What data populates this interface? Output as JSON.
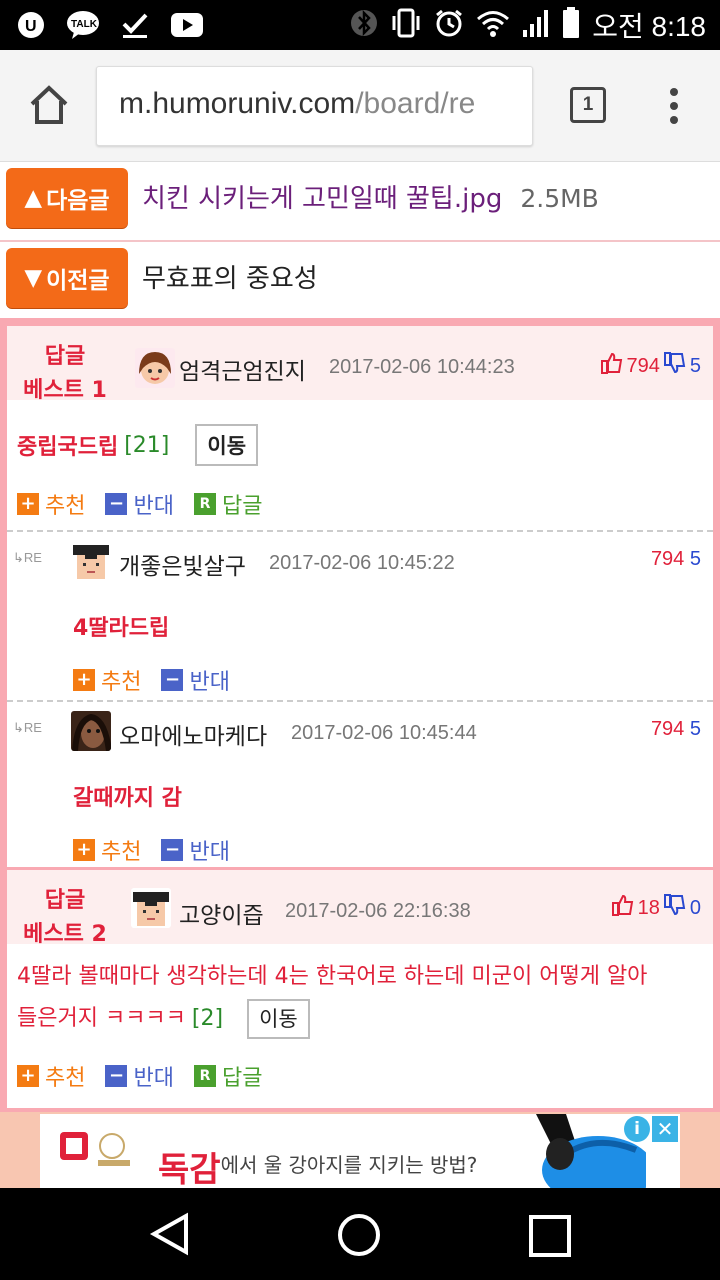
{
  "status_bar": {
    "time": "오전 8:18",
    "icons": [
      "u-plus-icon",
      "kakaotalk-icon",
      "checkmark-icon",
      "youtube-icon",
      "bluetooth-icon",
      "vibrate-icon",
      "alarm-icon",
      "wifi-icon",
      "signal-icon",
      "battery-icon"
    ],
    "kakao_label": "TALK"
  },
  "browser": {
    "url_host": "m.humoruniv.com",
    "url_path": "/board/re",
    "tab_count": "1"
  },
  "next_post": {
    "button_label": "다음글",
    "arrow": "▲",
    "title": "치킨 시키는게 고민일때 꿀팁.jpg",
    "size": "2.5MB"
  },
  "prev_post": {
    "button_label": "이전글",
    "arrow": "▼",
    "title": "무효표의 중요성"
  },
  "labels": {
    "recommend": "추천",
    "oppose": "반대",
    "reply": "답글",
    "move": "이동",
    "re": "RE"
  },
  "comments": [
    {
      "best_line1": "답글",
      "best_line2": "베스트 1",
      "author": "엄격근엄진지",
      "date": "2017-02-06 10:44:23",
      "up": "794",
      "down": "5",
      "body": "중립국드립",
      "reply_count": "[21]",
      "replies": [
        {
          "author": "개좋은빛살구",
          "date": "2017-02-06 10:45:22",
          "up": "794",
          "down": "5",
          "body": "4딸라드립"
        },
        {
          "author": "오마에노마케다",
          "date": "2017-02-06 10:45:44",
          "up": "794",
          "down": "5",
          "body": "갈때까지 감"
        }
      ]
    },
    {
      "best_line1": "답글",
      "best_line2": "베스트 2",
      "author": "고양이즙",
      "date": "2017-02-06 22:16:38",
      "up": "18",
      "down": "0",
      "body_line1": "4딸라 볼때마다 생각하는데 4는 한국어로 하는데 미군이 어떻게 알아",
      "body_line2": "들은거지 ㅋㅋㅋㅋ",
      "reply_count": "[2]"
    }
  ],
  "ad": {
    "headline": "독감",
    "text": "에서 울 강아지를 지키는 방법?",
    "info": "i",
    "close": "✕"
  }
}
